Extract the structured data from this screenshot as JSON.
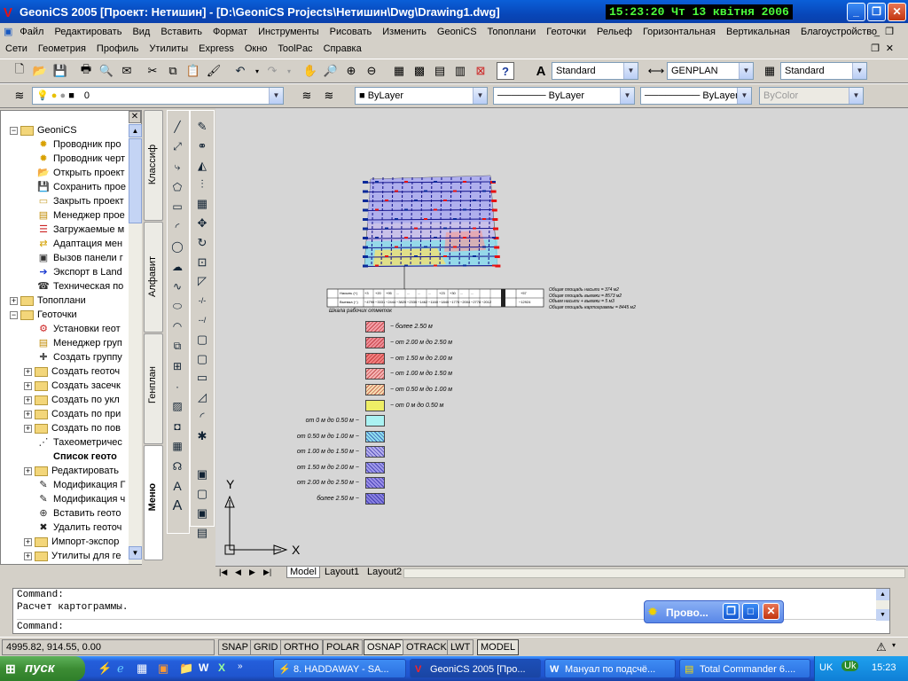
{
  "window": {
    "title": "GeoniCS 2005 [Проект: Нетишин] - [D:\\GeoniCS Projects\\Нетишин\\Dwg\\Drawing1.dwg]",
    "clock": "15:23:20  Чт 13 квітня 2006"
  },
  "menu1": [
    "Файл",
    "Редактировать",
    "Вид",
    "Вставить",
    "Формат",
    "Инструменты",
    "Рисовать",
    "Изменить",
    "GeoniCS",
    "Топоплани",
    "Геоточки",
    "Рельеф",
    "Горизонтальная",
    "Вертикальная",
    "Благоустройство"
  ],
  "menu2": [
    "Сети",
    "Геометрия",
    "Профиль",
    "Утилиты",
    "Express",
    "Окно",
    "ToolPac",
    "Справка"
  ],
  "styles": {
    "text_style": "Standard",
    "dim_style": "GENPLAN",
    "table_style": "Standard"
  },
  "layers": {
    "current_layer": "0",
    "color": "ByLayer",
    "linetype": "ByLayer",
    "lineweight": "ByLayer",
    "plotstyle": "ByColor"
  },
  "tree": [
    {
      "label": "GeoniCS",
      "type": "root",
      "pm": "−"
    },
    {
      "label": "Проводник про",
      "type": "item",
      "icon": "star-icon"
    },
    {
      "label": "Проводник черт",
      "type": "item",
      "icon": "star-icon"
    },
    {
      "label": "Открыть проект",
      "type": "item",
      "icon": "open-folder-icon"
    },
    {
      "label": "Сохранить прое",
      "type": "item",
      "icon": "save-icon"
    },
    {
      "label": "Закрыть проект",
      "type": "item",
      "icon": "folder-icon"
    },
    {
      "label": "Менеджер прое",
      "type": "item",
      "icon": "manager-icon"
    },
    {
      "label": "Загружаемые м",
      "type": "item",
      "icon": "list-icon"
    },
    {
      "label": "Адаптация мен",
      "type": "item",
      "icon": "adapt-icon"
    },
    {
      "label": "Вызов панели г",
      "type": "item",
      "icon": "panel-icon"
    },
    {
      "label": "Экспорт в Land",
      "type": "item",
      "icon": "export-icon"
    },
    {
      "label": "Техническая по",
      "type": "item",
      "icon": "phone-icon"
    },
    {
      "label": "Топоплани",
      "type": "group",
      "pm": "+"
    },
    {
      "label": "Геоточки",
      "type": "group",
      "pm": "−"
    },
    {
      "label": "Установки геот",
      "type": "sub",
      "icon": "settings-icon"
    },
    {
      "label": "Менеджер груп",
      "type": "sub",
      "icon": "manager-icon"
    },
    {
      "label": "Создать группу",
      "type": "sub",
      "icon": "create-icon"
    },
    {
      "label": "Создать геоточ",
      "type": "subgroup",
      "pm": "+"
    },
    {
      "label": "Создать засечк",
      "type": "subgroup",
      "pm": "+"
    },
    {
      "label": "Создать по укл",
      "type": "subgroup",
      "pm": "+"
    },
    {
      "label": "Создать по при",
      "type": "subgroup",
      "pm": "+"
    },
    {
      "label": "Создать по пов",
      "type": "subgroup",
      "pm": "+"
    },
    {
      "label": "Тахеометричес",
      "type": "sub",
      "icon": "tacho-icon"
    },
    {
      "label": "Список геото",
      "type": "sub",
      "icon": "blank",
      "bold": true
    },
    {
      "label": "Редактировать",
      "type": "subgroup",
      "pm": "+"
    },
    {
      "label": "Модификация Г",
      "type": "sub",
      "icon": "modify-icon"
    },
    {
      "label": "Модификация ч",
      "type": "sub",
      "icon": "modify-icon"
    },
    {
      "label": "Вставить геото",
      "type": "sub",
      "icon": "insert-icon"
    },
    {
      "label": "Удалить геоточ",
      "type": "sub",
      "icon": "delete-icon"
    },
    {
      "label": "Импорт-экспор",
      "type": "subgroup",
      "pm": "+"
    },
    {
      "label": "Утилиты для ге",
      "type": "subgroup",
      "pm": "+"
    }
  ],
  "side_tabs": [
    "Классиф",
    "Алфавит",
    "Генплан",
    "Меню"
  ],
  "drawing": {
    "table_row1": [
      "Насыпь (+)",
      "+3",
      "+20",
      "+95",
      "...",
      "...",
      "...",
      "...",
      "+23",
      "+30",
      "...",
      "...",
      "+57"
    ],
    "table_row2": [
      "Выемка (−)",
      "−4790",
      "−3331",
      "−2444",
      "−3820",
      "−2330",
      "−1462",
      "−1160",
      "−1840",
      "−1770",
      "−2004",
      "−2778",
      "−2012",
      "−12924"
    ],
    "table_notes": [
      "Общая площадь насыпи = 374 м2",
      "Общая площадь выемки = 8573 м2",
      "Объем насыпи + выемки = 5 м3",
      "Общая площадь картограммы = 8445 м2"
    ],
    "scale_caption": "Шкала рабочих отметок",
    "legend_positive": [
      "− более 2.50 м",
      "− от 2.00 м до 2.50 м",
      "− от 1.50 м до 2.00 м",
      "− от 1.00 м до 1.50 м",
      "− от 0.50 м до 1.00 м",
      "− от 0 м до 0.50 м"
    ],
    "legend_negative": [
      "от 0 м до 0.50 м −",
      "от 0.50 м до 1.00 м −",
      "от 1.00 м до 1.50 м −",
      "от 1.50 м до 2.00 м −",
      "от 2.00 м до 2.50 м −",
      "более 2.50 м −"
    ],
    "pos_colors": [
      "#f4a0a8",
      "#ef8f98",
      "#f08080",
      "#f5b3b3",
      "#f5ddb0",
      "#eeee66"
    ],
    "neg_colors": [
      "#aaf2f2",
      "#8ee0ee",
      "#b7b0ee",
      "#a09aea",
      "#9c90e8",
      "#8a82e0"
    ],
    "axis_y": "Y",
    "axis_x": "X"
  },
  "layout_tabs": [
    "Model",
    "Layout1",
    "Layout2"
  ],
  "command": {
    "line1": "Command:",
    "line2": "Расчет картограммы.",
    "prompt": "Command:"
  },
  "floating_panel": "Прово...",
  "status": {
    "coords": "4995.82, 914.55, 0.00",
    "buttons": [
      "SNAP",
      "GRID",
      "ORTHO",
      "POLAR",
      "OSNAP",
      "OTRACK",
      "LWT",
      "MODEL"
    ],
    "active": [
      "OSNAP",
      "MODEL"
    ]
  },
  "taskbar": {
    "start": "пуск",
    "tasks": [
      "8. HADDAWAY - SA...",
      "GeoniCS 2005 [Про...",
      "Мануал по подсчё...",
      "Total Commander 6...."
    ],
    "lang": "UK",
    "time": "15:23"
  }
}
